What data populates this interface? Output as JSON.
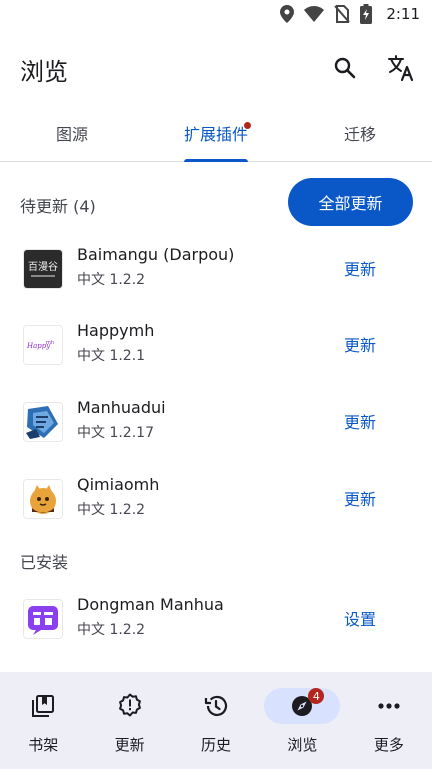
{
  "status_bar": {
    "time": "2:11"
  },
  "app_bar": {
    "title": "浏览"
  },
  "tabs": [
    {
      "label": "图源",
      "active": false,
      "has_dot": false
    },
    {
      "label": "扩展插件",
      "active": true,
      "has_dot": true
    },
    {
      "label": "迁移",
      "active": false,
      "has_dot": false
    }
  ],
  "pending": {
    "title": "待更新 (4)",
    "update_all_label": "全部更新",
    "items": [
      {
        "name": "Baimangu (Darpou)",
        "version": "中文 1.2.2",
        "action": "更新",
        "icon": "baimangu-icon"
      },
      {
        "name": "Happymh",
        "version": "中文 1.2.1",
        "action": "更新",
        "icon": "happymh-icon"
      },
      {
        "name": "Manhuadui",
        "version": "中文 1.2.17",
        "action": "更新",
        "icon": "manhuadui-icon"
      },
      {
        "name": "Qimiaomh",
        "version": "中文 1.2.2",
        "action": "更新",
        "icon": "qimiaomh-icon"
      }
    ]
  },
  "installed": {
    "title": "已安装",
    "items": [
      {
        "name": "Dongman Manhua",
        "version": "中文 1.2.2",
        "action": "设置",
        "icon": "dongman-icon"
      }
    ]
  },
  "bottom_nav": [
    {
      "label": "书架",
      "icon": "library-icon",
      "active": false
    },
    {
      "label": "更新",
      "icon": "updates-alert-icon",
      "active": false
    },
    {
      "label": "历史",
      "icon": "history-icon",
      "active": false
    },
    {
      "label": "浏览",
      "icon": "explore-icon",
      "active": true,
      "badge": "4"
    },
    {
      "label": "更多",
      "icon": "more-icon",
      "active": false
    }
  ],
  "colors": {
    "accent": "#0a58c8",
    "badge": "#b3261e",
    "nav_bg": "#eeeef6",
    "nav_active_pill": "#d8e2ff"
  }
}
